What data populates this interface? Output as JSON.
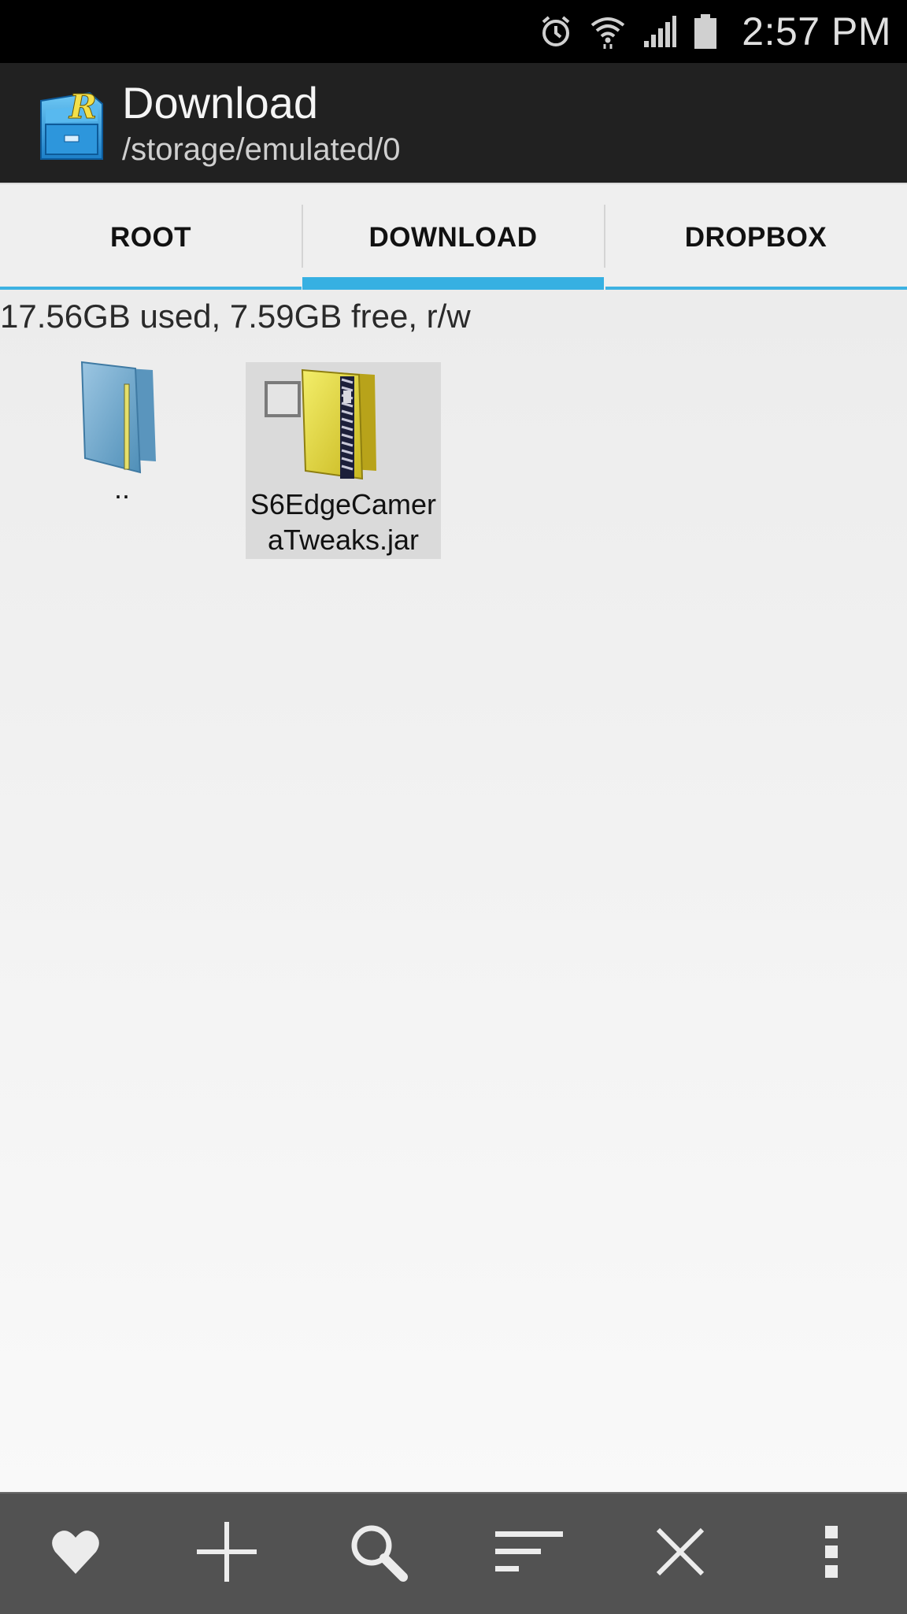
{
  "status_bar": {
    "time": "2:57 PM",
    "icons": [
      "alarm-icon",
      "wifi-icon",
      "signal-icon",
      "battery-icon"
    ]
  },
  "app_bar": {
    "title": "Download",
    "path": "/storage/emulated/0",
    "logo_letter": "R"
  },
  "tabs": [
    {
      "label": "ROOT",
      "active": false
    },
    {
      "label": "DOWNLOAD",
      "active": true
    },
    {
      "label": "DROPBOX",
      "active": false
    }
  ],
  "storage_info": "17.56GB used, 7.59GB free, r/w",
  "files": [
    {
      "name": "..",
      "type": "parent-folder",
      "selected": false
    },
    {
      "name_line1": "S6EdgeCamer",
      "name_line2": "aTweaks.jar",
      "type": "jar",
      "selected": false
    }
  ],
  "bottom_bar": {
    "buttons": [
      "favorite-icon",
      "add-icon",
      "search-icon",
      "sort-icon",
      "close-icon",
      "overflow-menu-icon"
    ]
  },
  "colors": {
    "accent": "#36b0e2",
    "appbar": "#212121",
    "bottombar": "#525252"
  }
}
